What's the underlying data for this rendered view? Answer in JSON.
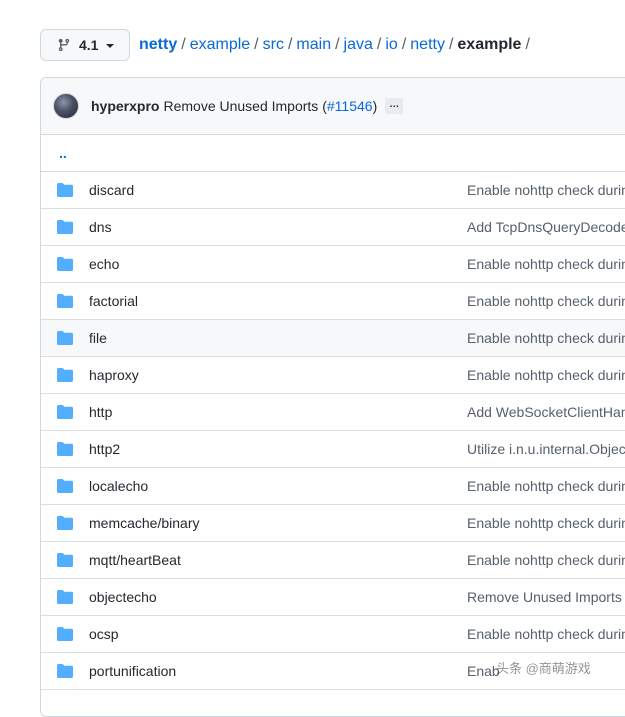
{
  "branch": {
    "label": "4.1"
  },
  "breadcrumb": {
    "root": "netty",
    "parts": [
      "example",
      "src",
      "main",
      "java",
      "io",
      "netty"
    ],
    "current": "example",
    "sep": "/"
  },
  "commit": {
    "author": "hyperxpro",
    "message_prefix": "Remove Unused Imports (",
    "pr_link": "#11546",
    "message_suffix": ")",
    "ellipsis": "…"
  },
  "parent_dir": {
    "label": ".."
  },
  "rows": [
    {
      "name": "discard",
      "message": "Enable nohttp check durin"
    },
    {
      "name": "dns",
      "message": "Add TcpDnsQueryDecode"
    },
    {
      "name": "echo",
      "message": "Enable nohttp check durin"
    },
    {
      "name": "factorial",
      "message": "Enable nohttp check durin"
    },
    {
      "name": "file",
      "message": "Enable nohttp check durin"
    },
    {
      "name": "haproxy",
      "message": "Enable nohttp check durin"
    },
    {
      "name": "http",
      "message": "Add WebSocketClientHan"
    },
    {
      "name": "http2",
      "message": "Utilize i.n.u.internal.Object"
    },
    {
      "name": "localecho",
      "message": "Enable nohttp check durin"
    },
    {
      "name": "memcache/binary",
      "message": "Enable nohttp check durin"
    },
    {
      "name": "mqtt/heartBeat",
      "message": "Enable nohttp check durin"
    },
    {
      "name": "objectecho",
      "message": "Remove Unused Imports ("
    },
    {
      "name": "ocsp",
      "message": "Enable nohttp check durin"
    },
    {
      "name": "portunification",
      "message": "Enab"
    }
  ],
  "watermark": {
    "text": "头条 @商萌游戏"
  },
  "colors": {
    "link": "#0969da",
    "folder": "#54aeff",
    "border": "#d0d7de",
    "muted": "#57606a",
    "header_bg": "#f6f8fa"
  },
  "icons": {
    "branch": "git-branch-icon",
    "caret": "caret-down-icon",
    "folder": "folder-icon"
  }
}
